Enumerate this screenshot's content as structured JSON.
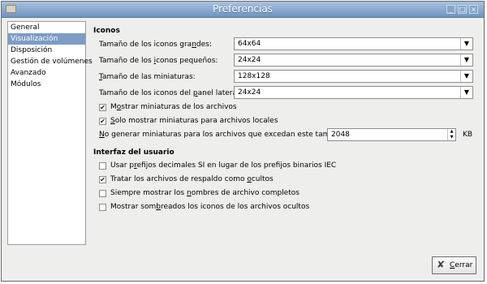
{
  "window": {
    "title": "Preferencias",
    "controls": [
      "_",
      "□",
      "×"
    ]
  },
  "sidebar": {
    "items": [
      {
        "label": "General"
      },
      {
        "label": "Visualización"
      },
      {
        "label": "Disposición"
      },
      {
        "label": "Gestión de volúmenes"
      },
      {
        "label": "Avanzado"
      },
      {
        "label": "Módulos"
      }
    ],
    "selected": "Visualización"
  },
  "icons_section": {
    "title": "Iconos",
    "rows": [
      {
        "label_pre": "Tamaño de los iconos gra",
        "label_u": "n",
        "label_post": "des:",
        "value": "64x64"
      },
      {
        "label_pre": "Tamaño de los ",
        "label_u": "i",
        "label_post": "conos pequeños:",
        "value": "24x24"
      },
      {
        "label_pre": "",
        "label_u": "T",
        "label_post": "amaño de las miniaturas:",
        "value": "128x128"
      },
      {
        "label_pre": "Tamaño de los iconos del ",
        "label_u": "p",
        "label_post": "anel lateral:",
        "value": "24x24"
      }
    ],
    "checks": [
      {
        "label_pre": "M",
        "label_u": "o",
        "label_post": "strar miniaturas de los archivos",
        "checked": true
      },
      {
        "label_pre": "",
        "label_u": "S",
        "label_post": "olo mostrar miniaturas para archivos locales",
        "checked": true
      }
    ],
    "limit": {
      "label_pre": "",
      "label_u": "N",
      "label_post": "o generar miniaturas para los archivos que excedan este tamaño:",
      "value": "2048",
      "unit": "KB"
    }
  },
  "ui_section": {
    "title": "Interfaz del usuario",
    "checks": [
      {
        "label_pre": "Usar p",
        "label_u": "r",
        "label_post": "efijos decimales SI en lugar de los prefijos binarios IEC",
        "checked": false
      },
      {
        "label_pre": "Tratar los archivos de respaldo como ",
        "label_u": "o",
        "label_post": "cultos",
        "checked": true
      },
      {
        "label_pre": "Siempre mostrar los ",
        "label_u": "n",
        "label_post": "ombres de archivo completos",
        "checked": false
      },
      {
        "label_pre": "Mostrar som",
        "label_u": "b",
        "label_post": "reados los iconos de los archivos ocultos",
        "checked": false
      }
    ]
  },
  "close_button": {
    "label_pre": "",
    "label_u": "C",
    "label_post": "errar"
  },
  "glyphs": {
    "check": "✔",
    "arrow_down": "▼",
    "spin_up": "▲",
    "spin_down": "▼",
    "close_x": "✘"
  }
}
